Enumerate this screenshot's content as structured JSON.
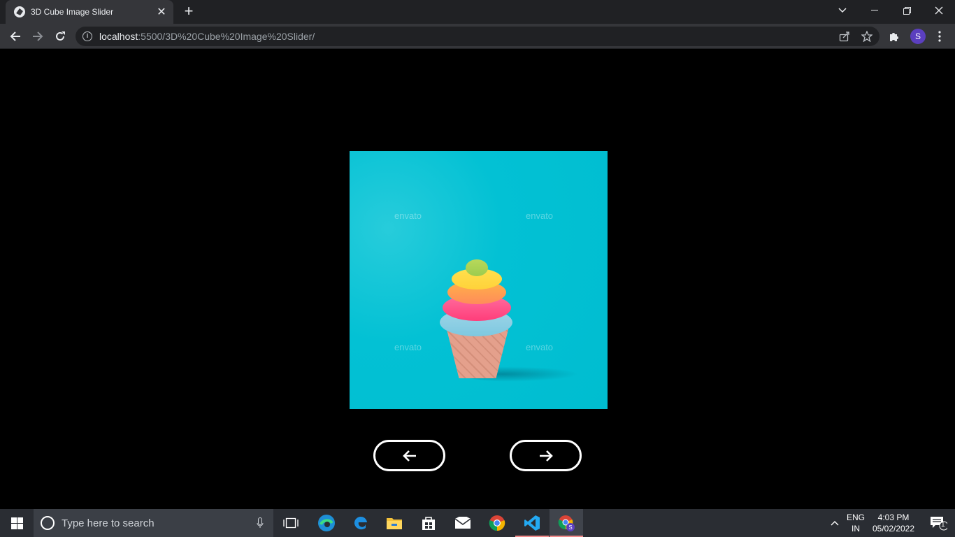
{
  "browser": {
    "tab": {
      "title": "3D Cube Image Slider",
      "close": "✕"
    },
    "new_tab": "+",
    "url": {
      "host": "localhost",
      "rest": ":5500/3D%20Cube%20Image%20Slider/"
    },
    "profile_initial": "S"
  },
  "slider": {
    "watermarks": [
      "envato",
      "envato",
      "envato",
      "envato"
    ],
    "colors": {
      "background": "#00c3d6",
      "button_border": "#ffffff"
    },
    "buttons": {
      "prev": "arrow-left-icon",
      "next": "arrow-right-icon"
    }
  },
  "taskbar": {
    "search_placeholder": "Type here to search",
    "language": {
      "line1": "ENG",
      "line2": "IN"
    },
    "clock": {
      "time": "4:03 PM",
      "date": "05/02/2022"
    },
    "notification_count": "1"
  }
}
